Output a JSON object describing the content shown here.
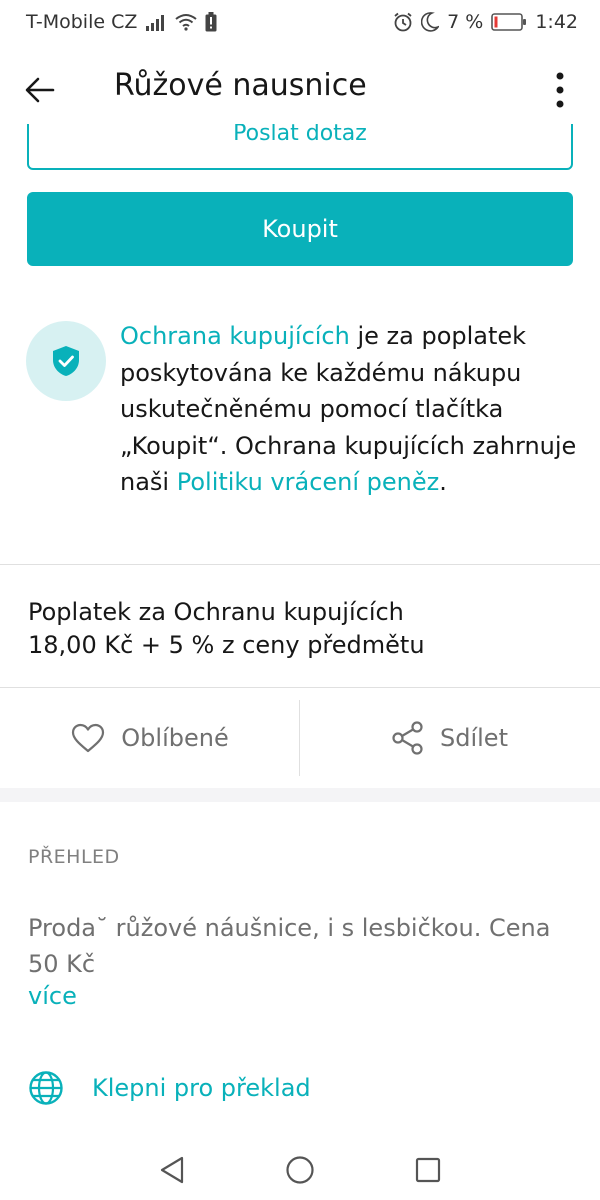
{
  "status_bar": {
    "carrier": "T-Mobile CZ",
    "battery_percent": "7 %",
    "time": "1:42"
  },
  "app_bar": {
    "title": "Růžové nausnice"
  },
  "buttons": {
    "ask_label": "Poslat dotaz",
    "buy_label": "Koupit"
  },
  "buyer_protection": {
    "link_text": "Ochrana kupujících",
    "text_1": " je za poplatek poskytována ke každému nákupu uskutečněnému pomocí tlačítka „Koupit“. Ochrana kupujících zahrnuje naši ",
    "policy_link": "Politiku vrácení peněz",
    "text_2": "."
  },
  "fee": {
    "title": "Poplatek za Ochranu kupujících",
    "value": "18,00 Kč + 5 % z ceny předmětu"
  },
  "actions": {
    "favourite_label": "Oblíbené",
    "share_label": "Sdílet"
  },
  "overview": {
    "heading": "PŘEHLED",
    "description": "Proda˘ růžové náušnice, i s lesbičkou. Cena 50 Kč",
    "more_link": "více",
    "translate_label": "Klepni pro překlad"
  },
  "colors": {
    "accent": "#09b1ba",
    "accent_light": "#d7f1f2",
    "text": "#171717",
    "muted": "#707070"
  },
  "icons": [
    "signal-icon",
    "wifi-icon",
    "battery-alert-icon",
    "alarm-icon",
    "moon-icon",
    "battery-icon",
    "back-arrow-icon",
    "more-vert-icon",
    "shield-check-icon",
    "heart-icon",
    "share-icon",
    "globe-icon",
    "nav-back-icon",
    "nav-home-icon",
    "nav-recents-icon"
  ]
}
